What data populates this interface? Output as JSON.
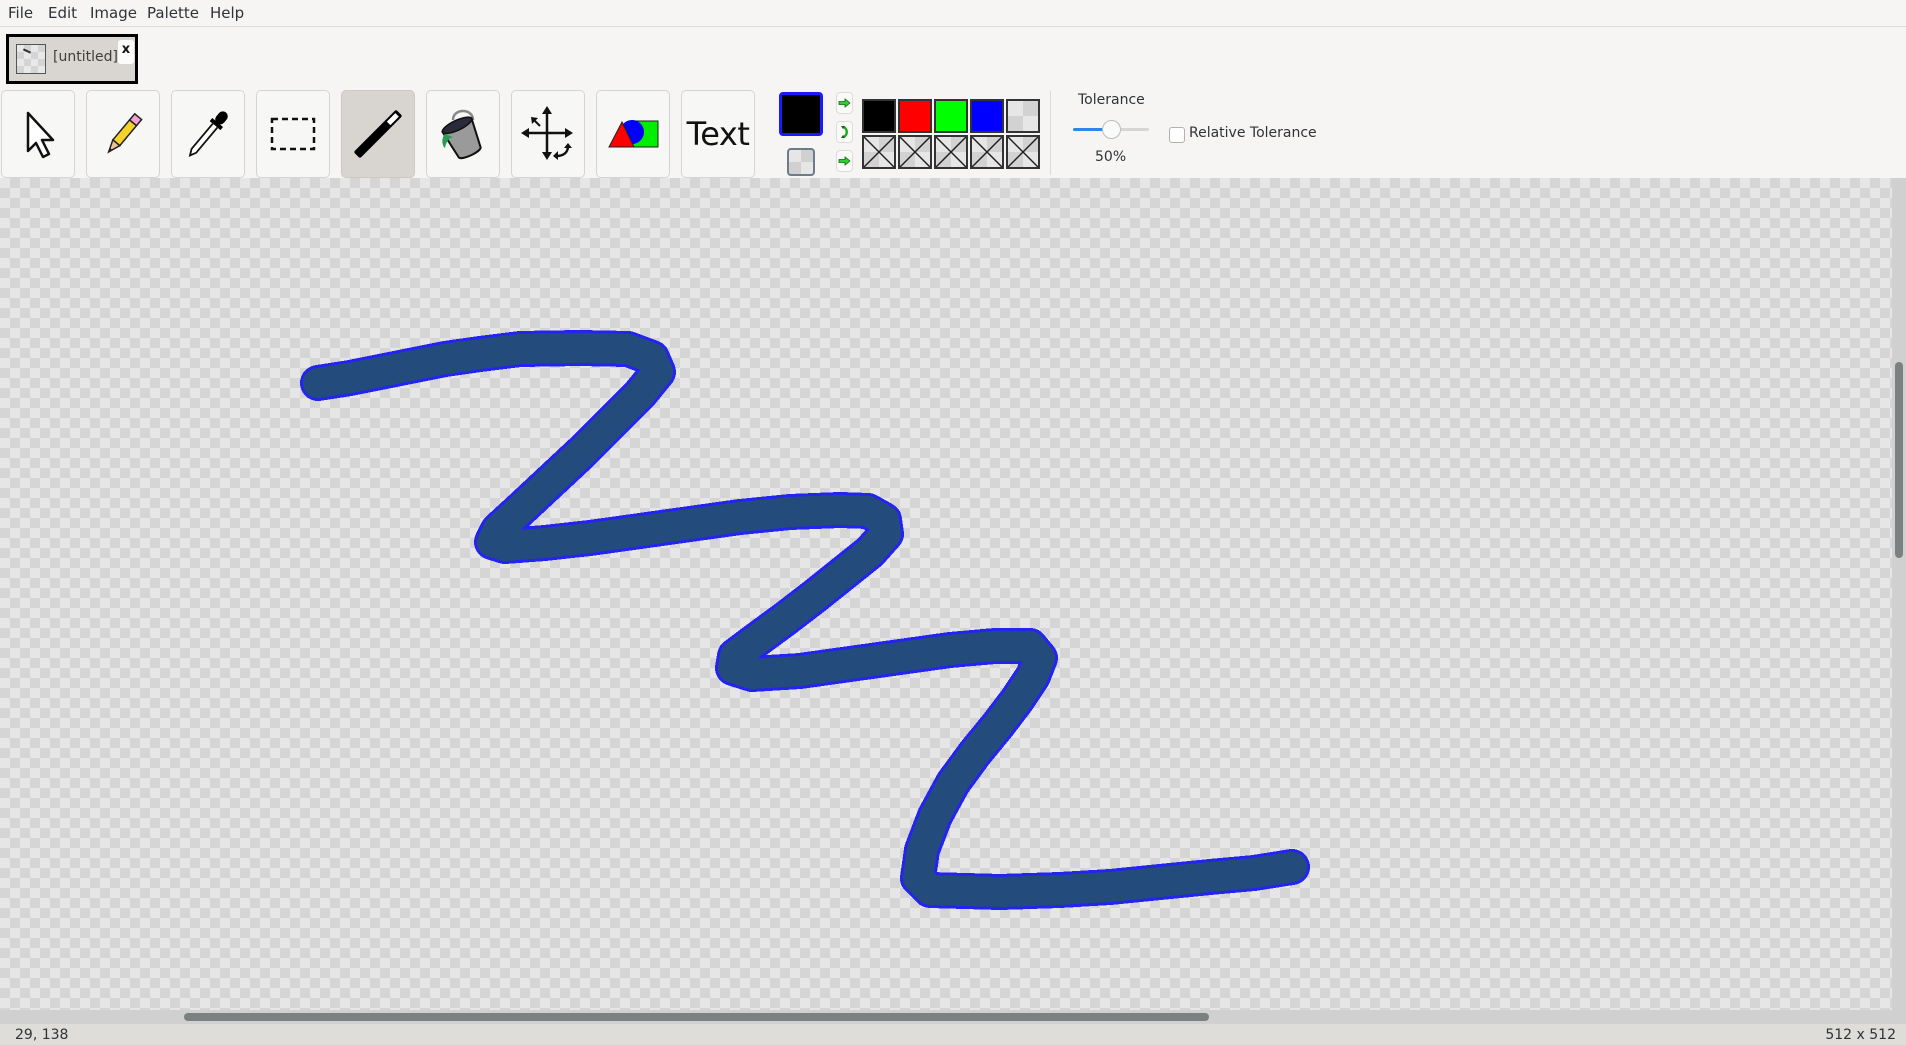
{
  "menu": {
    "items": [
      {
        "label": "File"
      },
      {
        "label": "Edit"
      },
      {
        "label": "Image"
      },
      {
        "label": "Palette"
      },
      {
        "label": "Help"
      }
    ]
  },
  "tabs": {
    "documents": [
      {
        "title": "[untitled]",
        "close_label": "x",
        "active": true
      }
    ]
  },
  "toolbar": {
    "tools": [
      {
        "name": "pointer",
        "icon": "arrow-pointer-icon",
        "active": false
      },
      {
        "name": "pencil",
        "icon": "pencil-icon",
        "active": false
      },
      {
        "name": "color-picker",
        "icon": "eyedropper-icon",
        "active": false
      },
      {
        "name": "rectangle-select",
        "icon": "dashed-rectangle-icon",
        "active": false
      },
      {
        "name": "magic-wand",
        "icon": "magic-wand-icon",
        "active": true
      },
      {
        "name": "fill",
        "icon": "paint-bucket-icon",
        "active": false
      },
      {
        "name": "move",
        "icon": "move-arrows-icon",
        "active": false
      },
      {
        "name": "shapes",
        "icon": "shapes-icon",
        "active": false
      },
      {
        "name": "text",
        "icon": "text-icon",
        "label": "Text",
        "active": false
      }
    ],
    "colors": {
      "primary": "#000000",
      "primary_border": "#1a1aff",
      "secondary": "transparent",
      "swap_buttons": [
        "set-primary-arrow-icon",
        "swap-colors-icon",
        "set-secondary-arrow-icon"
      ],
      "palette": [
        {
          "color": "#000000"
        },
        {
          "color": "#ff0000"
        },
        {
          "color": "#00ff00"
        },
        {
          "color": "#0000ff"
        },
        {
          "color": "transparent"
        },
        {
          "color": "empty"
        },
        {
          "color": "empty"
        },
        {
          "color": "empty"
        },
        {
          "color": "empty"
        },
        {
          "color": "empty"
        }
      ]
    },
    "tolerance": {
      "label": "Tolerance",
      "value_percent": 50,
      "value_label": "50%",
      "relative_label": "Relative Tolerance",
      "relative_checked": false
    }
  },
  "canvas": {
    "stroke_fill": "#234c7d",
    "stroke_outline": "#2424f0",
    "background": "transparent-checkerboard"
  },
  "scroll": {
    "horizontal_fraction_start": 0.097,
    "horizontal_fraction_visible": 0.542,
    "vertical_fraction_start": 0.221,
    "vertical_fraction_visible": 0.236
  },
  "status": {
    "cursor_position": "29, 138",
    "image_size": "512 x 512"
  }
}
